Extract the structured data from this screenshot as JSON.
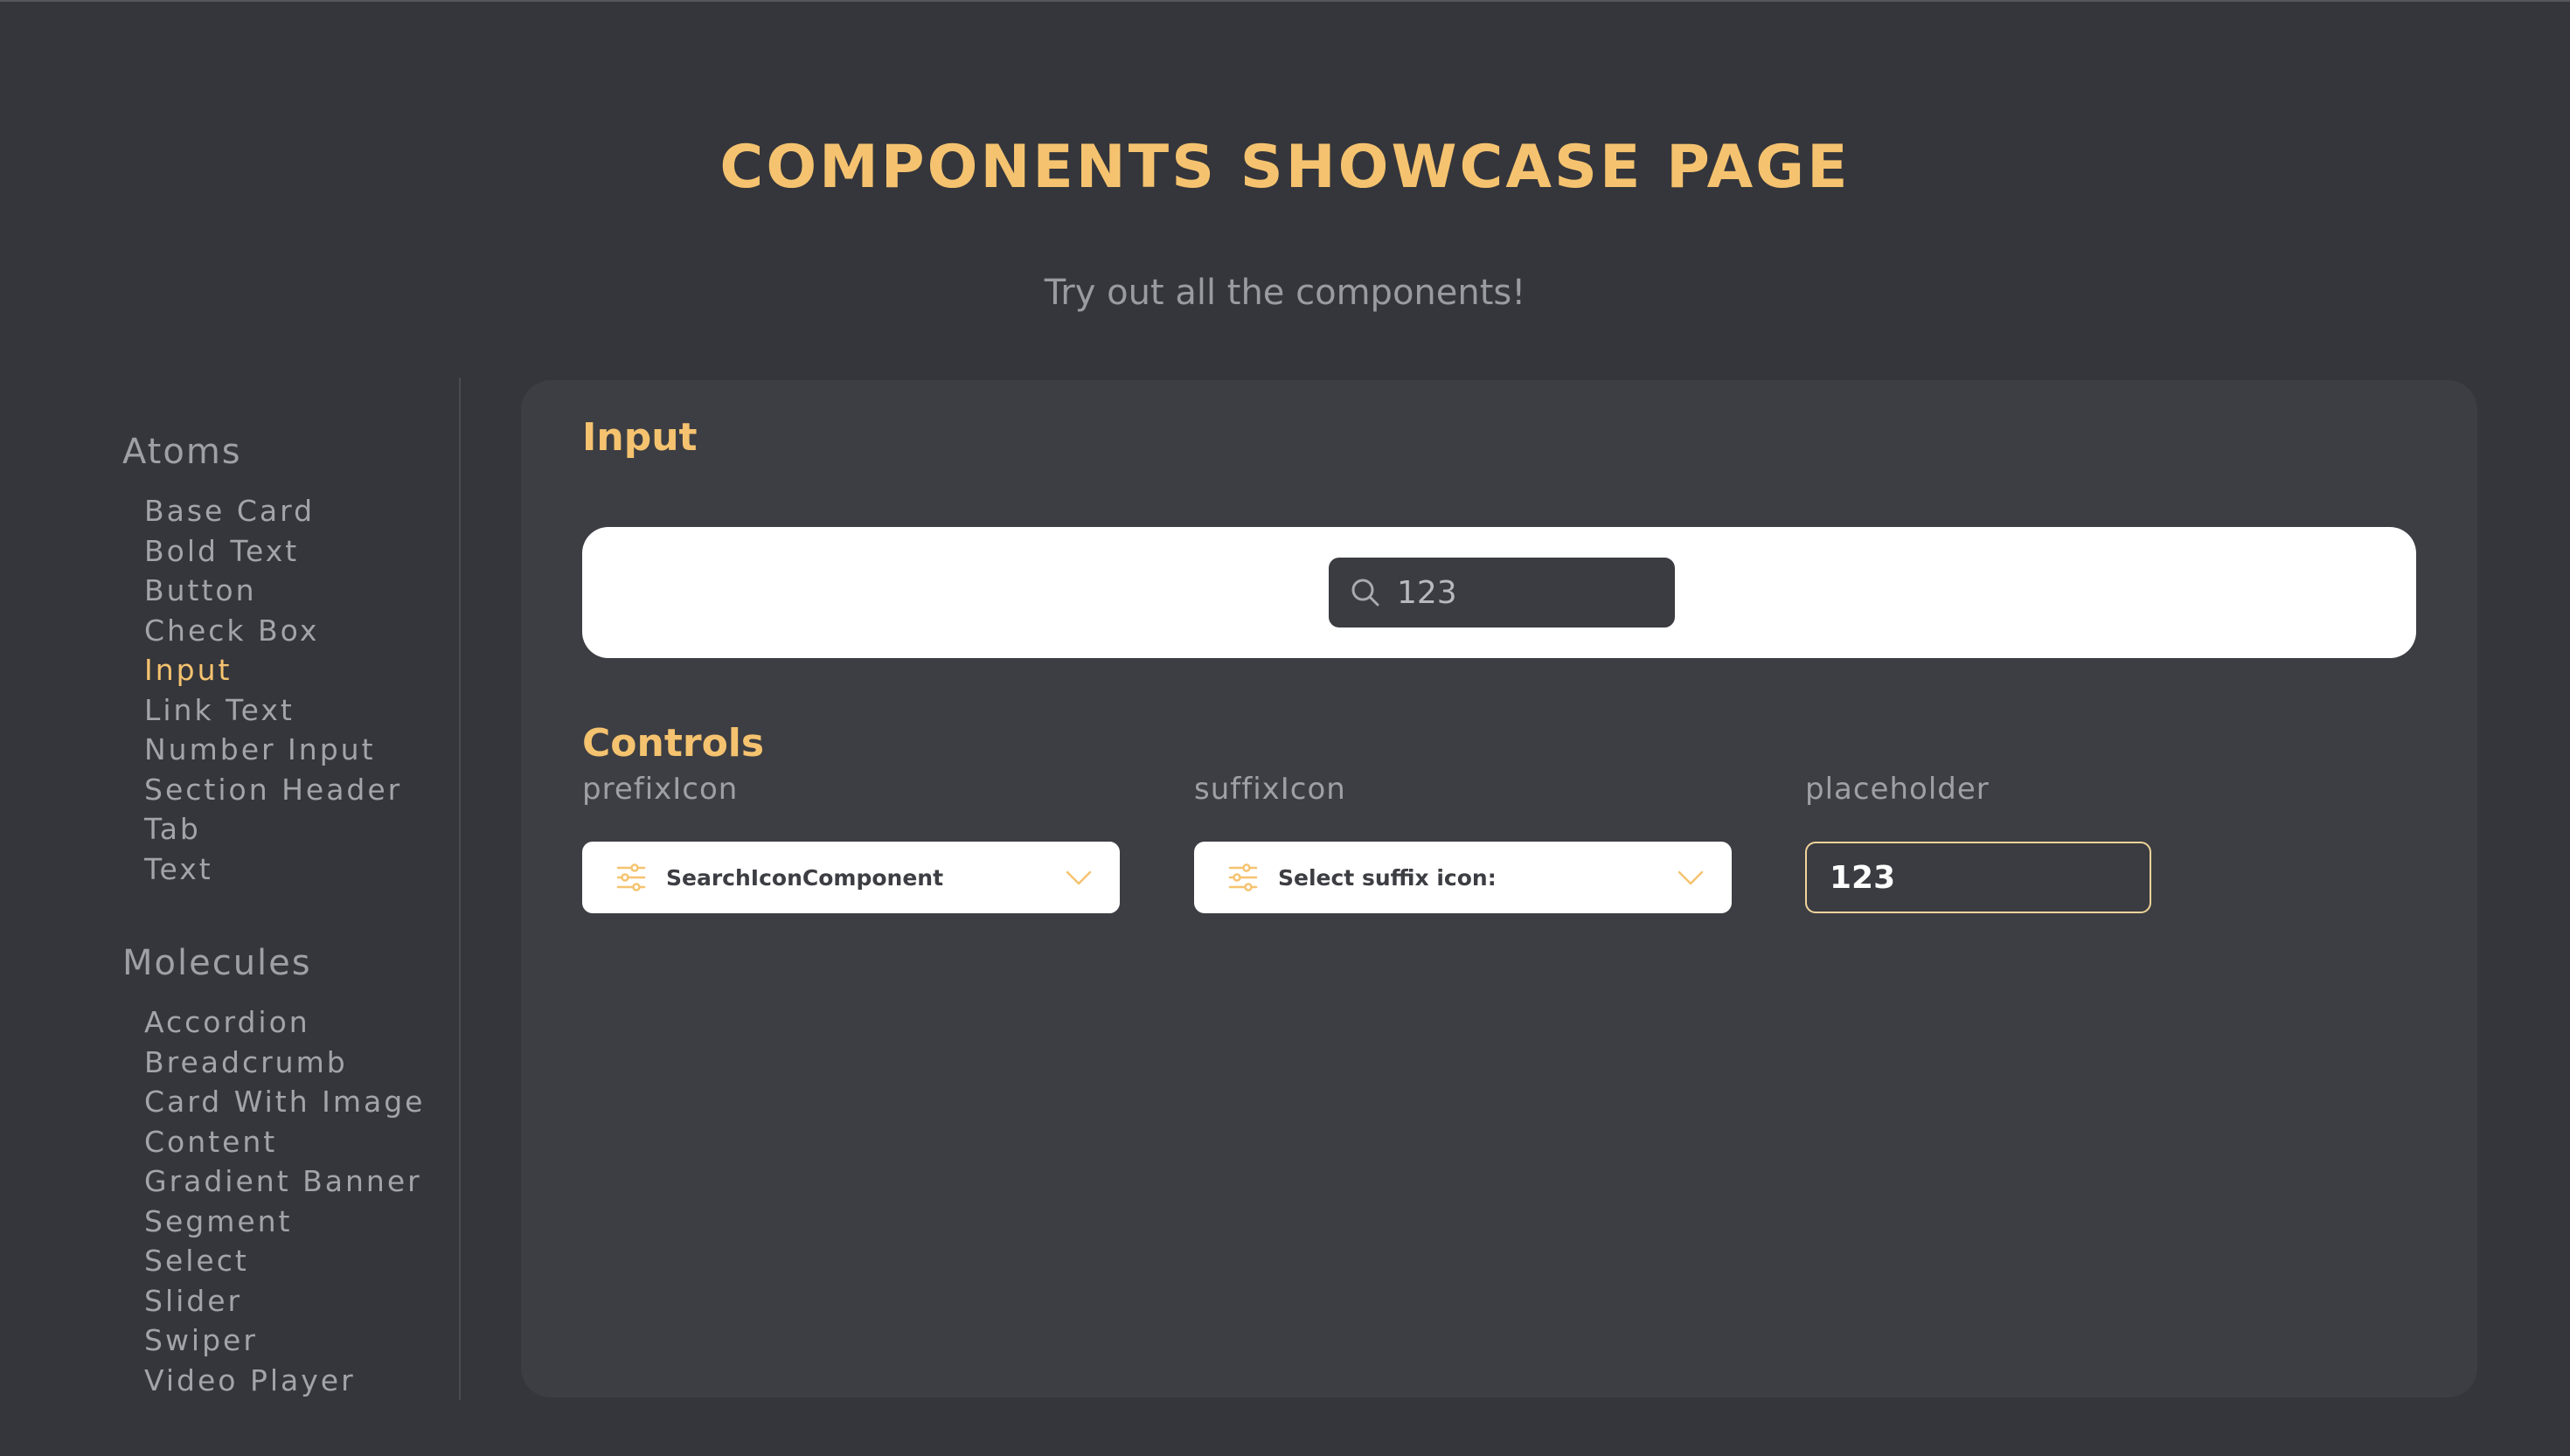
{
  "header": {
    "title": "COMPONENTS SHOWCASE PAGE",
    "subtitle": "Try out all the components!"
  },
  "sidebar": {
    "groups": [
      {
        "title": "Atoms",
        "items": [
          "Base Card",
          "Bold Text",
          "Button",
          "Check Box",
          "Input",
          "Link Text",
          "Number Input",
          "Section Header",
          "Tab",
          "Text"
        ]
      },
      {
        "title": "Molecules",
        "items": [
          "Accordion",
          "Breadcrumb",
          "Card With Image Content",
          "Gradient Banner",
          "Segment",
          "Select",
          "Slider",
          "Swiper",
          "Video Player"
        ]
      }
    ],
    "active_item": "Input"
  },
  "main": {
    "section_title": "Input",
    "preview": {
      "input_value": "123",
      "prefix_icon": "search-icon"
    },
    "controls_title": "Controls",
    "controls": {
      "prefix_icon": {
        "label": "prefixIcon",
        "value": "SearchIconComponent",
        "icon": "sliders-icon"
      },
      "suffix_icon": {
        "label": "suffixIcon",
        "value": "Select suffix icon:",
        "icon": "sliders-icon"
      },
      "placeholder": {
        "label": "placeholder",
        "value": "123"
      }
    }
  },
  "colors": {
    "background": "#35363b",
    "panel": "#3d3e43",
    "accent": "#f5c36f",
    "muted_text": "#9fa0a6"
  }
}
